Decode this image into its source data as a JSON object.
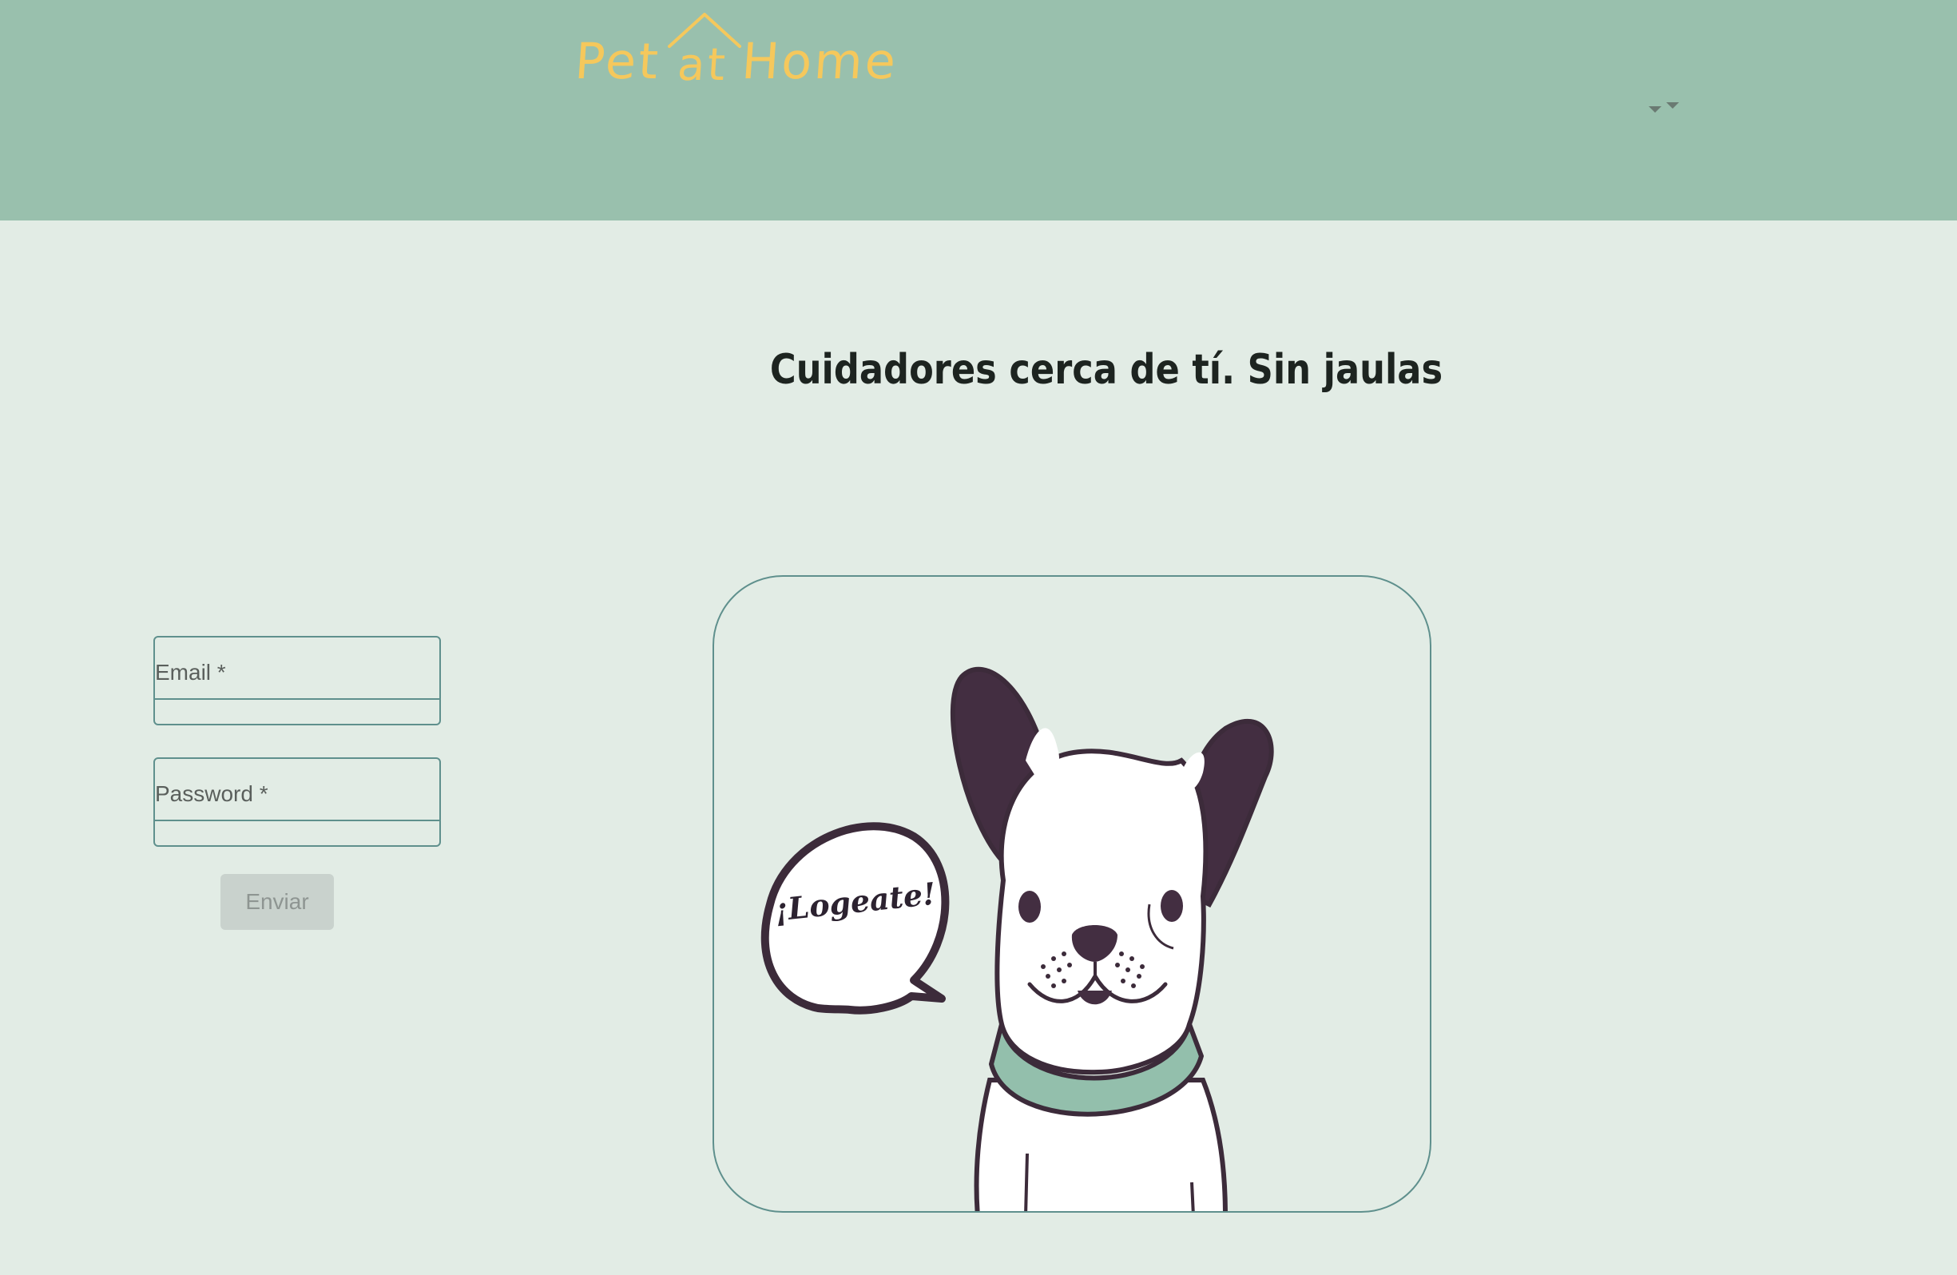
{
  "header": {
    "logo_text_left": "Pet",
    "logo_text_at": "at",
    "logo_text_right": "Home",
    "menu_icon": "chevron-down-icon",
    "background_color": "#99c0ad",
    "logo_color": "#f5c85c"
  },
  "main": {
    "headline": "Cuidadores cerca de tí. Sin jaulas"
  },
  "login_form": {
    "email_label": "Email *",
    "password_label": "Password *",
    "submit_label": "Enviar",
    "border_color": "#5f908d"
  },
  "illustration": {
    "speech_bubble_text": "¡Logeate!",
    "collar_color": "#93bfac",
    "ear_color": "#432e41"
  }
}
